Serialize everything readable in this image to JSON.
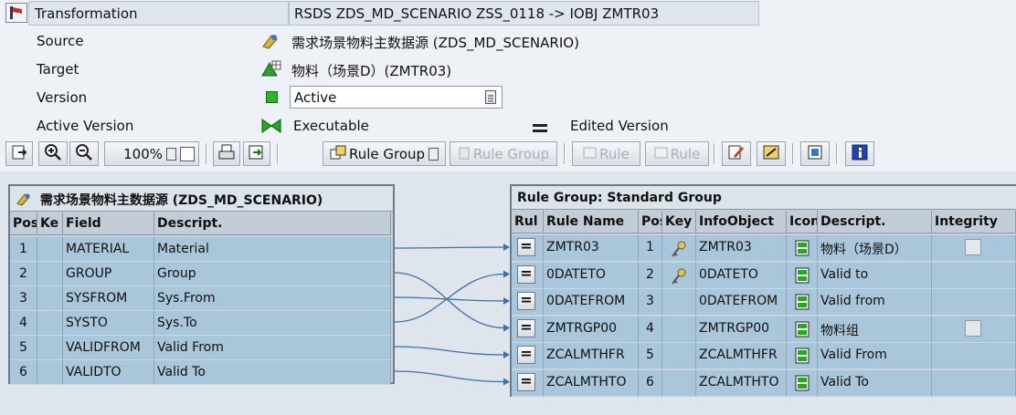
{
  "header": {
    "transformation_label": "Transformation",
    "transformation_value": "RSDS ZDS_MD_SCENARIO ZSS_0118 -> IOBJ ZMTR03",
    "source_label": "Source",
    "source_value": "需求场景物料主数据源 (ZDS_MD_SCENARIO)",
    "target_label": "Target",
    "target_value": "物料（场景D）(ZMTR03)",
    "version_label": "Version",
    "version_value": "Active",
    "active_version_label": "Active Version",
    "active_version_value": "Executable",
    "edited_version_label": "Edited Version",
    "status_color": "#22aa22"
  },
  "toolbar": {
    "zoom": "100%",
    "rule_group_label": "Rule Group",
    "rule_group_disabled_label": "Rule Group",
    "rule_add_label": "Rule",
    "rule_del_label": "Rule"
  },
  "source_panel": {
    "title": "需求场景物料主数据源 (ZDS_MD_SCENARIO)",
    "columns": [
      "Pos",
      "Ke",
      "Field",
      "Descript."
    ],
    "rows": [
      {
        "pos": "1",
        "field": "MATERIAL",
        "desc": "Material"
      },
      {
        "pos": "2",
        "field": "GROUP",
        "desc": "Group"
      },
      {
        "pos": "3",
        "field": "SYSFROM",
        "desc": "Sys.From"
      },
      {
        "pos": "4",
        "field": "SYSTO",
        "desc": "Sys.To"
      },
      {
        "pos": "5",
        "field": "VALIDFROM",
        "desc": "Valid From"
      },
      {
        "pos": "6",
        "field": "VALIDTO",
        "desc": "Valid To"
      }
    ]
  },
  "target_panel": {
    "title": "Rule Group: Standard Group",
    "columns": [
      "Rul",
      "Rule Name",
      "Pos",
      "Key",
      "InfoObject",
      "Icon",
      "Descript.",
      "Integrity"
    ],
    "rows": [
      {
        "rule_name": "ZMTR03",
        "pos": "1",
        "key": true,
        "infoobject": "ZMTR03",
        "desc": "物料（场景D）",
        "integrity": true
      },
      {
        "rule_name": "0DATETO",
        "pos": "2",
        "key": true,
        "infoobject": "0DATETO",
        "desc": "Valid to",
        "integrity": false
      },
      {
        "rule_name": "0DATEFROM",
        "pos": "3",
        "key": false,
        "infoobject": "0DATEFROM",
        "desc": "Valid from",
        "integrity": false
      },
      {
        "rule_name": "ZMTRGP00",
        "pos": "4",
        "key": false,
        "infoobject": "ZMTRGP00",
        "desc": "物料组",
        "integrity": true
      },
      {
        "rule_name": "ZCALMTHFR",
        "pos": "5",
        "key": false,
        "infoobject": "ZCALMTHFR",
        "desc": "Valid From",
        "integrity": false
      },
      {
        "rule_name": "ZCALMTHTO",
        "pos": "6",
        "key": false,
        "infoobject": "ZCALMTHTO",
        "desc": "Valid To",
        "integrity": false
      }
    ],
    "mappings": [
      [
        1,
        1
      ],
      [
        2,
        4
      ],
      [
        3,
        3
      ],
      [
        4,
        2
      ],
      [
        5,
        5
      ],
      [
        6,
        6
      ]
    ]
  }
}
